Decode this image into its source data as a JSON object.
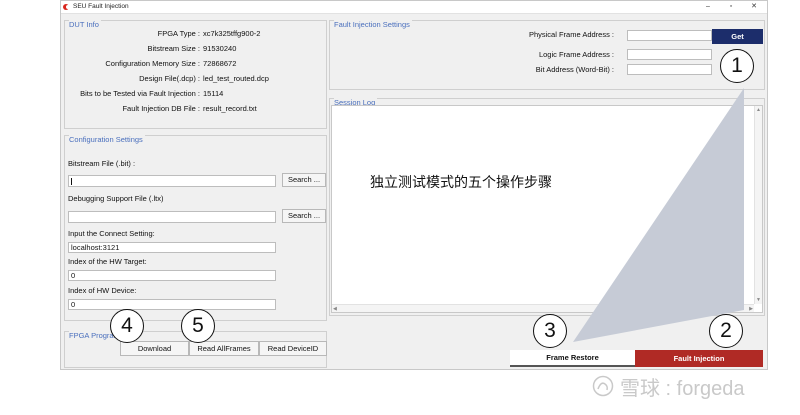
{
  "window": {
    "title": "SEU Fault Injection",
    "controls": [
      "–",
      "▫",
      "✕"
    ]
  },
  "dut_info": {
    "title": "DUT Info",
    "rows": [
      {
        "label": "FPGA Type :",
        "value": "xc7k325tffg900-2"
      },
      {
        "label": "Bitstream Size :",
        "value": "91530240"
      },
      {
        "label": "Configuration Memory Size :",
        "value": "72868672"
      },
      {
        "label": "Design File(.dcp) :",
        "value": "led_test_routed.dcp"
      },
      {
        "label": "Bits to be Tested via Fault Injection :",
        "value": "15114"
      },
      {
        "label": "Fault Injection DB File :",
        "value": "result_record.txt"
      }
    ]
  },
  "config": {
    "title": "Configuration Settings",
    "bitstream_label": "Bitstream File (.bit) :",
    "bitstream_value": "",
    "search_label": "Search ...",
    "debug_label": "Debugging Support File (.ltx)",
    "debug_value": "",
    "connect_label": "Input the Connect Setting:",
    "connect_value": "localhost:3121",
    "target_label": "Index of the HW Target:",
    "target_value": "0",
    "device_label": "Index of HW Device:",
    "device_value": "0"
  },
  "fpga_prog": {
    "title": "FPGA Program",
    "download": "Download",
    "read_all": "Read AllFrames",
    "read_id": "Read DeviceID"
  },
  "fault_settings": {
    "title": "Fault Injection Settings",
    "physical_label": "Physical Frame Address :",
    "physical_value": "",
    "logic_label": "Logic Frame Address :",
    "logic_value": "",
    "bit_label": "Bit Address (Word-Bit) :",
    "bit_value": "",
    "get_label": "Get"
  },
  "session": {
    "title": "Session Log"
  },
  "bottom": {
    "frame_restore": "Frame Restore",
    "fault_injection": "Fault Injection"
  },
  "annotation": {
    "caption": "独立测试模式的五个操作步骤",
    "steps": [
      "1",
      "2",
      "3",
      "4",
      "5"
    ]
  },
  "watermark": {
    "text": "雪球 : forgeda"
  },
  "colors": {
    "accent_blue": "#1c2d6b",
    "accent_red": "#b02a25",
    "panel_title": "#4a6fbd",
    "callout": "#c6cbd6"
  }
}
